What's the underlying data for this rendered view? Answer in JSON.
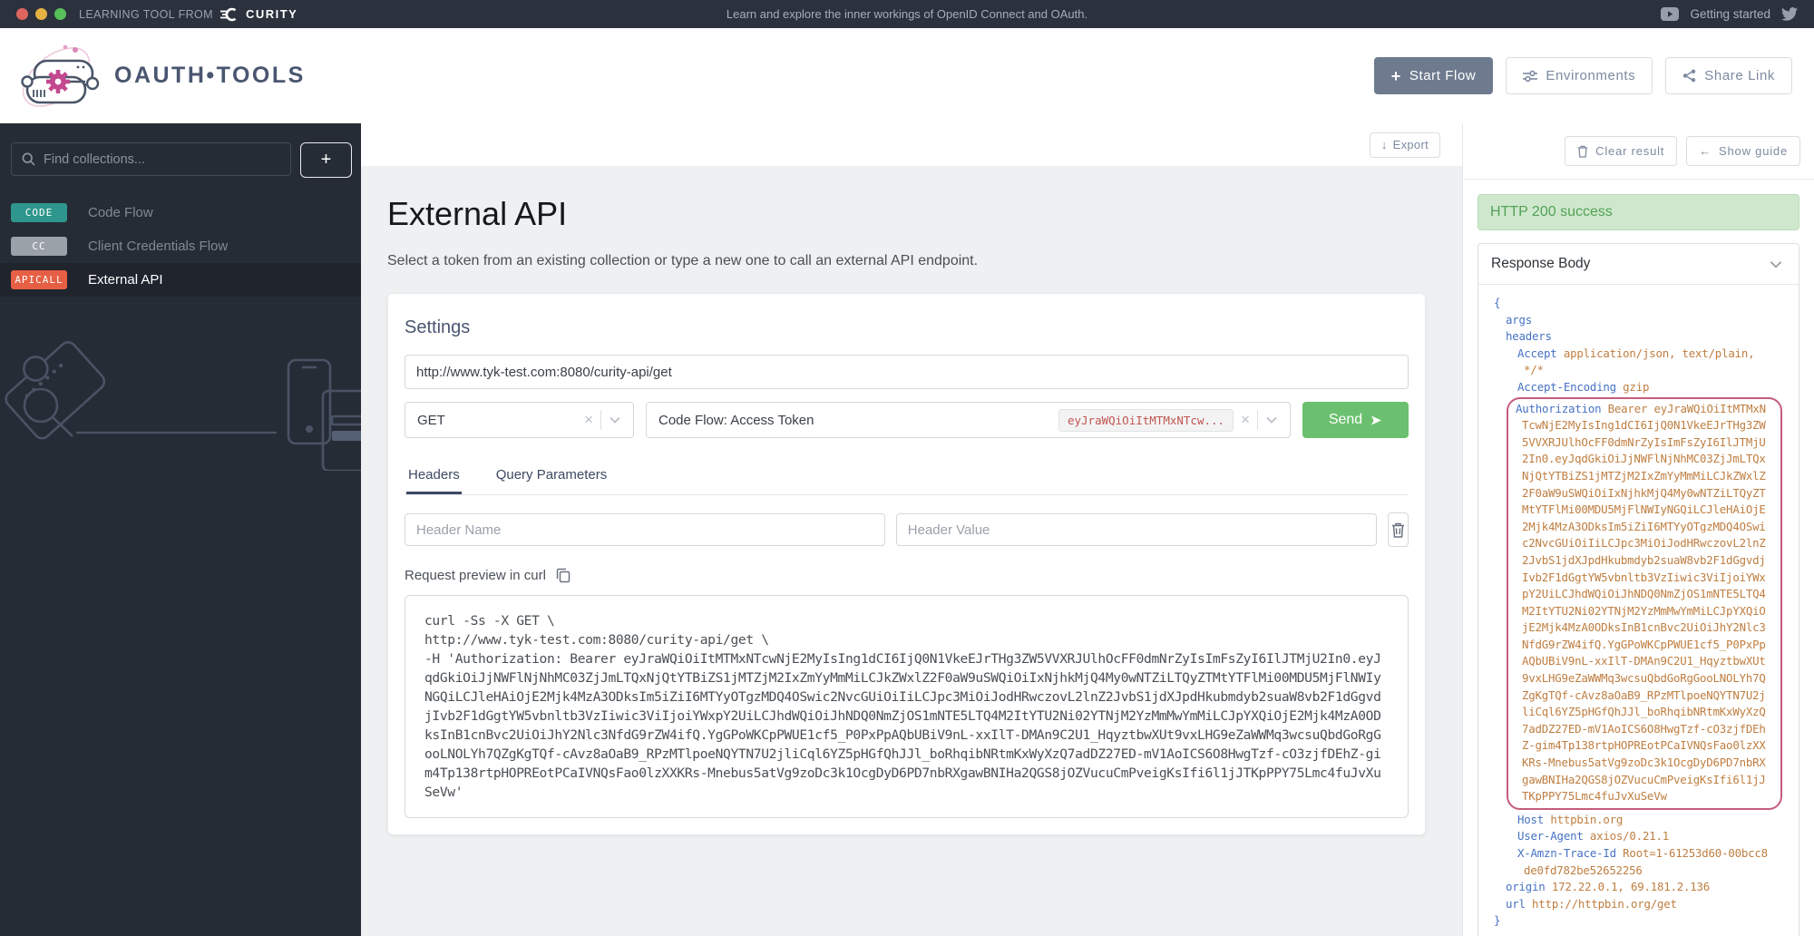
{
  "topbar": {
    "brand_prefix": "LEARNING TOOL FROM",
    "brand_name": "CURITY",
    "tagline": "Learn and explore the inner workings of OpenID Connect and OAuth.",
    "getting_started": "Getting started"
  },
  "header": {
    "app_name": "OAUTH•TOOLS",
    "start_flow_label": "Start Flow",
    "environments_label": "Environments",
    "share_link_label": "Share Link"
  },
  "sidebar": {
    "search_placeholder": "Find collections...",
    "add_button": "+",
    "collections": [
      {
        "badge": "CODE",
        "badge_color": "#2e968c",
        "label": "Code Flow",
        "selected": false
      },
      {
        "badge": "CC",
        "badge_color": "#9ba1a8",
        "label": "Client Credentials Flow",
        "selected": false
      },
      {
        "badge": "APICALL",
        "badge_color": "#e65f44",
        "label": "External API",
        "selected": true
      }
    ]
  },
  "main": {
    "export_label": "Export",
    "title": "External API",
    "subtitle": "Select a token from an existing collection or type a new one to call an external API endpoint.",
    "settings": {
      "heading": "Settings",
      "url_value": "http://www.tyk-test.com:8080/curity-api/get",
      "method_value": "GET",
      "token_select_value": "Code Flow: Access Token",
      "token_chip": "eyJraWQiOiItMTMxNTcw...",
      "send_label": "Send",
      "tab_headers": "Headers",
      "tab_query": "Query Parameters",
      "header_name_placeholder": "Header Name",
      "header_value_placeholder": "Header Value",
      "curl_label": "Request preview in curl",
      "curl_lines": [
        "curl -Ss -X GET \\",
        "http://www.tyk-test.com:8080/curity-api/get \\",
        "-H 'Authorization: Bearer eyJraWQiOiItMTMxNTcwNjE2MyIsIng1dCI6IjQ0N1VkeEJrTHg3ZW5VVXRJUlhOcFF0dmNrZyIsImFsZyI6IlJTMjU2In0.eyJ",
        "qdGkiOiJjNWFlNjNhMC03ZjJmLTQxNjQtYTBiZS1jMTZjM2IxZmYyMmMiLCJkZWxlZ2F0aW9uSWQiOiIxNjhkMjQ4My0wNTZiLTQyZTMtYTFlMi00MDU5MjFlNWIy",
        "NGQiLCJleHAiOjE2Mjk4MzA3ODksIm5iZiI6MTYyOTgzMDQ4OSwic2NvcGUiOiIiLCJpc3MiOiJodHRwczovL2lnZ2JvbS1jdXJpdHkubmdyb2suaW8vb2F1dGgvd",
        "jIvb2F1dGgtYW5vbnltb3VzIiwic3ViIjoiYWxpY2UiLCJhdWQiOiJhNDQ0NmZjOS1mNTE5LTQ4M2ItYTU2Ni02YTNjM2YzMmMwYmMiLCJpYXQiOjE2Mjk4MzA0OD",
        "ksInB1cnBvc2UiOiJhY2Nlc3NfdG9rZW4ifQ.YgGPoWKCpPWUE1cf5_P0PxPpAQbUBiV9nL-xxIlT-DMAn9C2U1_HqyztbwXUt9vxLHG9eZaWWMq3wcsuQbdGoRgG",
        "ooLNOLYh7QZgKgTQf-cAvz8aOaB9_RPzMTlpoeNQYTN7U2jliCql6YZ5pHGfQhJJl_boRhqibNRtmKxWyXzQ7adDZ27ED-mV1AoICS6O8HwgTzf-cO3zjfDEhZ-gi",
        "m4Tp138rtpHOPREotPCaIVNQsFao0lzXXKRs-Mnebus5atVg9zoDc3k1OcgDyD6PD7nbRXgawBNIHa2QGS8jOZVucuCmPveigKsIfi6l1jJTKpPPY75Lmc4fuJvXu",
        "SeVw'"
      ]
    }
  },
  "result": {
    "clear_label": "Clear result",
    "guide_label": "Show guide",
    "status_banner": "HTTP 200 success",
    "response_body_title": "Response Body",
    "response": {
      "open": "{",
      "close": "}",
      "lines_before": [
        {
          "indent": 1,
          "key": "args"
        },
        {
          "indent": 1,
          "key": "headers"
        },
        {
          "indent": 2,
          "key": "Accept",
          "val": "application/json, text/plain,"
        },
        {
          "indent": 2,
          "cont": true,
          "val": "*/*"
        },
        {
          "indent": 2,
          "key": "Accept-Encoding",
          "val": "gzip"
        }
      ],
      "authorization": {
        "key": "Authorization",
        "lines": [
          "Bearer eyJraWQiOiItMTMxN",
          "TcwNjE2MyIsIng1dCI6IjQ0N1VkeEJrTHg3ZW",
          "5VVXRJUlhOcFF0dmNrZyIsImFsZyI6IlJTMjU",
          "2In0.eyJqdGkiOiJjNWFlNjNhMC03ZjJmLTQx",
          "NjQtYTBiZS1jMTZjM2IxZmYyMmMiLCJkZWxlZ",
          "2F0aW9uSWQiOiIxNjhkMjQ4My0wNTZiLTQyZT",
          "MtYTFlMi00MDU5MjFlNWIyNGQiLCJleHAiOjE",
          "2Mjk4MzA3ODksIm5iZiI6MTYyOTgzMDQ4OSwi",
          "c2NvcGUiOiIiLCJpc3MiOiJodHRwczovL2lnZ",
          "2JvbS1jdXJpdHkubmdyb2suaW8vb2F1dGgvdj",
          "Ivb2F1dGgtYW5vbnltb3VzIiwic3ViIjoiYWx",
          "pY2UiLCJhdWQiOiJhNDQ0NmZjOS1mNTE5LTQ4",
          "M2ItYTU2Ni02YTNjM2YzMmMwYmMiLCJpYXQiO",
          "jE2Mjk4MzA0ODksInB1cnBvc2UiOiJhY2Nlc3",
          "NfdG9rZW4ifQ.YgGPoWKCpPWUE1cf5_P0PxPp",
          "AQbUBiV9nL-xxIlT-DMAn9C2U1_HqyztbwXUt",
          "9vxLHG9eZaWWMq3wcsuQbdGoRgGooLNOLYh7Q",
          "ZgKgTQf-cAvz8aOaB9_RPzMTlpoeNQYTN7U2j",
          "liCql6YZ5pHGfQhJJl_boRhqibNRtmKxWyXzQ",
          "7adDZ27ED-mV1AoICS6O8HwgTzf-cO3zjfDEh",
          "Z-gim4Tp138rtpHOPREotPCaIVNQsFao0lzXX",
          "KRs-Mnebus5atVg9zoDc3k1OcgDyD6PD7nbRX",
          "gawBNIHa2QGS8jOZVucuCmPveigKsIfi6l1jJ",
          "TKpPPY75Lmc4fuJvXuSeVw"
        ]
      },
      "lines_after": [
        {
          "indent": 2,
          "key": "Host",
          "val": "httpbin.org"
        },
        {
          "indent": 2,
          "key": "User-Agent",
          "val": "axios/0.21.1"
        },
        {
          "indent": 2,
          "key": "X-Amzn-Trace-Id",
          "val": "Root=1-61253d60-00bcc8"
        },
        {
          "indent": 2,
          "cont": true,
          "val": "de0fd782be52652256"
        },
        {
          "indent": 1,
          "key": "origin",
          "val": "172.22.0.1, 69.181.2.136"
        },
        {
          "indent": 1,
          "key": "url",
          "val": "http://httpbin.org/get"
        }
      ]
    }
  },
  "colors": {
    "accent_slate": "#4a5670",
    "primary_button": "#6e7b8f",
    "send_green": "#6bc06f",
    "success_bg": "#cfe8cd",
    "success_text": "#53a158",
    "json_key_blue": "#4672c4",
    "json_value_orange": "#bf7e41",
    "token_outline_pink": "#c45d7c",
    "token_chip_red": "#c0564f"
  }
}
